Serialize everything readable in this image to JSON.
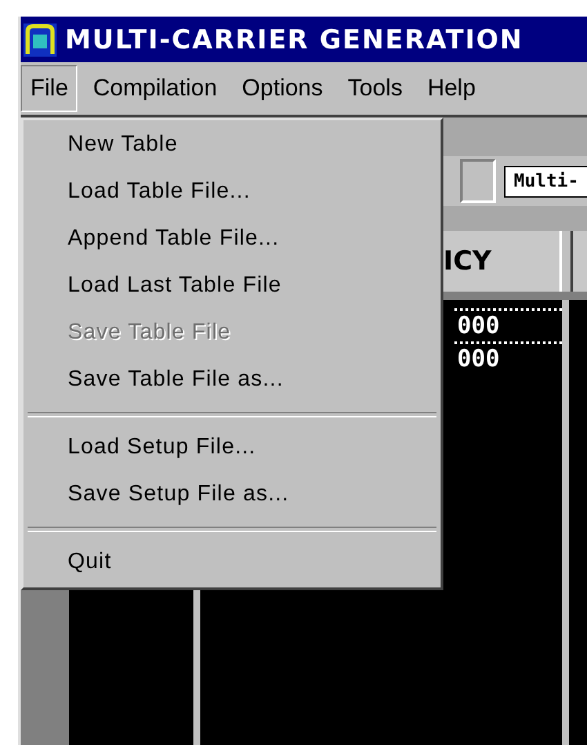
{
  "window": {
    "title": "MULTI-CARRIER GENERATION"
  },
  "menu_bar": [
    {
      "label": "File",
      "selected": true
    },
    {
      "label": "Compilation",
      "selected": false
    },
    {
      "label": "Options",
      "selected": false
    },
    {
      "label": "Tools",
      "selected": false
    },
    {
      "label": "Help",
      "selected": false
    }
  ],
  "toolbar": {
    "button": "Multi-"
  },
  "table": {
    "column_heading": "ICY",
    "rows": [
      "000",
      "000"
    ]
  },
  "file_menu": [
    {
      "kind": "item",
      "label": "New Table",
      "disabled": false
    },
    {
      "kind": "item",
      "label": "Load Table File...",
      "disabled": false
    },
    {
      "kind": "item",
      "label": "Append Table File...",
      "disabled": false
    },
    {
      "kind": "item",
      "label": "Load Last Table File",
      "disabled": false
    },
    {
      "kind": "item",
      "label": "Save Table File",
      "disabled": true
    },
    {
      "kind": "item",
      "label": "Save Table File as...",
      "disabled": false
    },
    {
      "kind": "separator"
    },
    {
      "kind": "item",
      "label": "Load Setup File...",
      "disabled": false
    },
    {
      "kind": "item",
      "label": "Save Setup File as...",
      "disabled": false
    },
    {
      "kind": "separator"
    },
    {
      "kind": "item",
      "label": "Quit",
      "disabled": false
    }
  ]
}
